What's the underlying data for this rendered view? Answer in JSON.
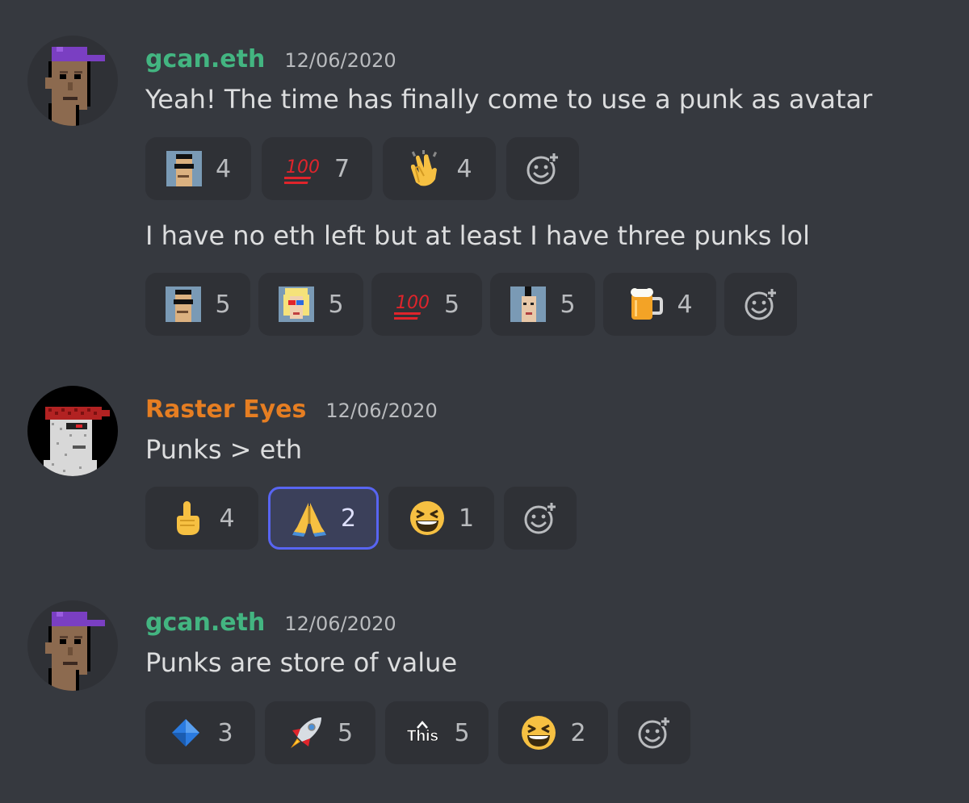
{
  "messages": [
    {
      "author": "gcan.eth",
      "author_color": "#43b581",
      "timestamp": "12/06/2020",
      "avatar": "punk-avatar-purple-cap",
      "lines": [
        {
          "text": "Yeah! The time has finally come to use a punk as avatar",
          "reactions": [
            {
              "emoji": "punk-sunglasses-icon",
              "count": "4"
            },
            {
              "emoji": "hundred-points-icon",
              "count": "7"
            },
            {
              "emoji": "clapping-hands-icon",
              "count": "4"
            },
            {
              "emoji": "add-reaction-icon"
            }
          ]
        },
        {
          "text": "I have no eth left but at least I have three punks lol",
          "reactions": [
            {
              "emoji": "punk-sunglasses-icon",
              "count": "5"
            },
            {
              "emoji": "punk-blonde-3d-glasses-icon",
              "count": "5"
            },
            {
              "emoji": "hundred-points-icon",
              "count": "5"
            },
            {
              "emoji": "punk-mohawk-icon",
              "count": "5"
            },
            {
              "emoji": "beer-mug-icon",
              "count": "4"
            },
            {
              "emoji": "add-reaction-icon"
            }
          ]
        }
      ]
    },
    {
      "author": "Raster Eyes",
      "author_color": "#e67e22",
      "timestamp": "12/06/2020",
      "avatar": "punk-avatar-bandana",
      "lines": [
        {
          "text": "Punks > eth",
          "reactions": [
            {
              "emoji": "index-pointing-up-icon",
              "count": "4"
            },
            {
              "emoji": "folded-hands-icon",
              "count": "2",
              "active": true
            },
            {
              "emoji": "grinning-squinting-face-icon",
              "count": "1"
            },
            {
              "emoji": "add-reaction-icon"
            }
          ]
        }
      ]
    },
    {
      "author": "gcan.eth",
      "author_color": "#43b581",
      "timestamp": "12/06/2020",
      "avatar": "punk-avatar-purple-cap",
      "lines": [
        {
          "text": "Punks are store of value",
          "reactions": [
            {
              "emoji": "blue-diamond-icon",
              "count": "3"
            },
            {
              "emoji": "rocket-icon",
              "count": "5"
            },
            {
              "emoji": "this-arrow-icon",
              "emoji_text": "This",
              "count": "5"
            },
            {
              "emoji": "grinning-squinting-face-icon",
              "count": "2"
            },
            {
              "emoji": "add-reaction-icon"
            }
          ]
        }
      ]
    }
  ],
  "colors": {
    "background": "#36393f",
    "reaction_bg": "#2f3136",
    "reaction_active_border": "#5865f2",
    "text": "#dcddde",
    "muted": "#b9bbbe"
  }
}
